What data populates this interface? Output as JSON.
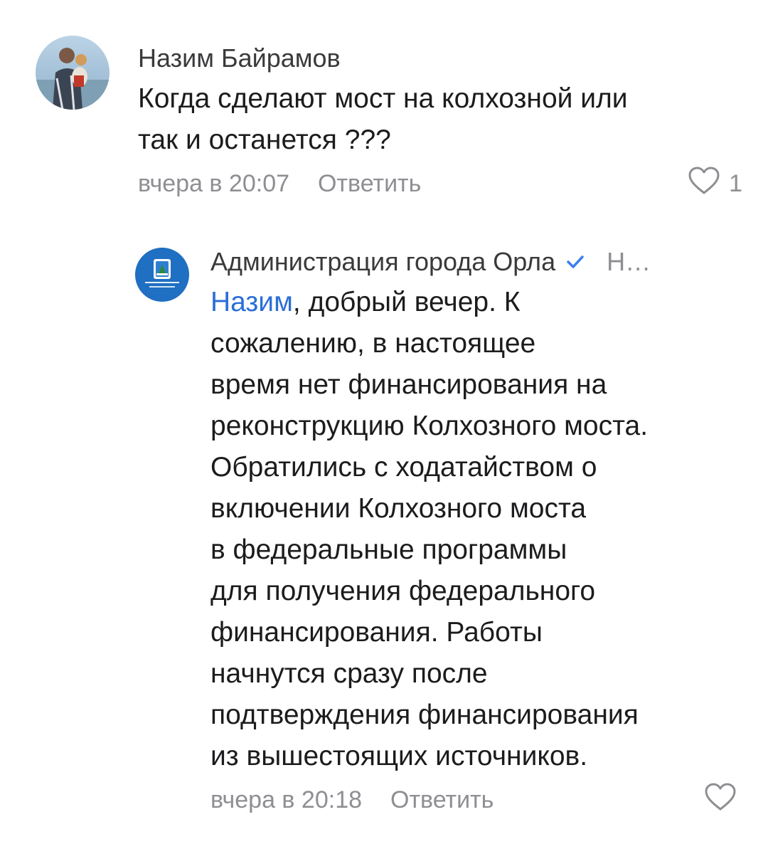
{
  "comments": [
    {
      "author": "Назим Байрамов",
      "text_lines": [
        "Когда сделают мост на колхозной или",
        "так и останется ???"
      ],
      "time": "вчера в 20:07",
      "reply_label": "Ответить",
      "like_icon": "heart-outline-icon",
      "like_count": "1"
    },
    {
      "author": "Администрация города Орла",
      "verified_icon": "checkmark-icon",
      "truncated_name": "Н…",
      "mention": "Назим",
      "first_line_rest": ", добрый вечер. К",
      "text_lines": [
        "сожалению, в настоящее",
        "время нет финансирования на",
        "реконструкцию Колхозного моста.",
        "Обратились с ходатайством о",
        "включении Колхозного моста",
        "в федеральные программы",
        "для получения федерального",
        "финансирования. Работы",
        "начнутся сразу после",
        "подтверждения финансирования",
        "из вышестоящих источников."
      ],
      "time": "вчера в 20:18",
      "reply_label": "Ответить",
      "like_icon": "heart-outline-icon"
    }
  ],
  "colors": {
    "text": "#1c1c1e",
    "secondary": "#8e8e93",
    "link": "#2b6fd6",
    "verified": "#3d7ff0"
  }
}
